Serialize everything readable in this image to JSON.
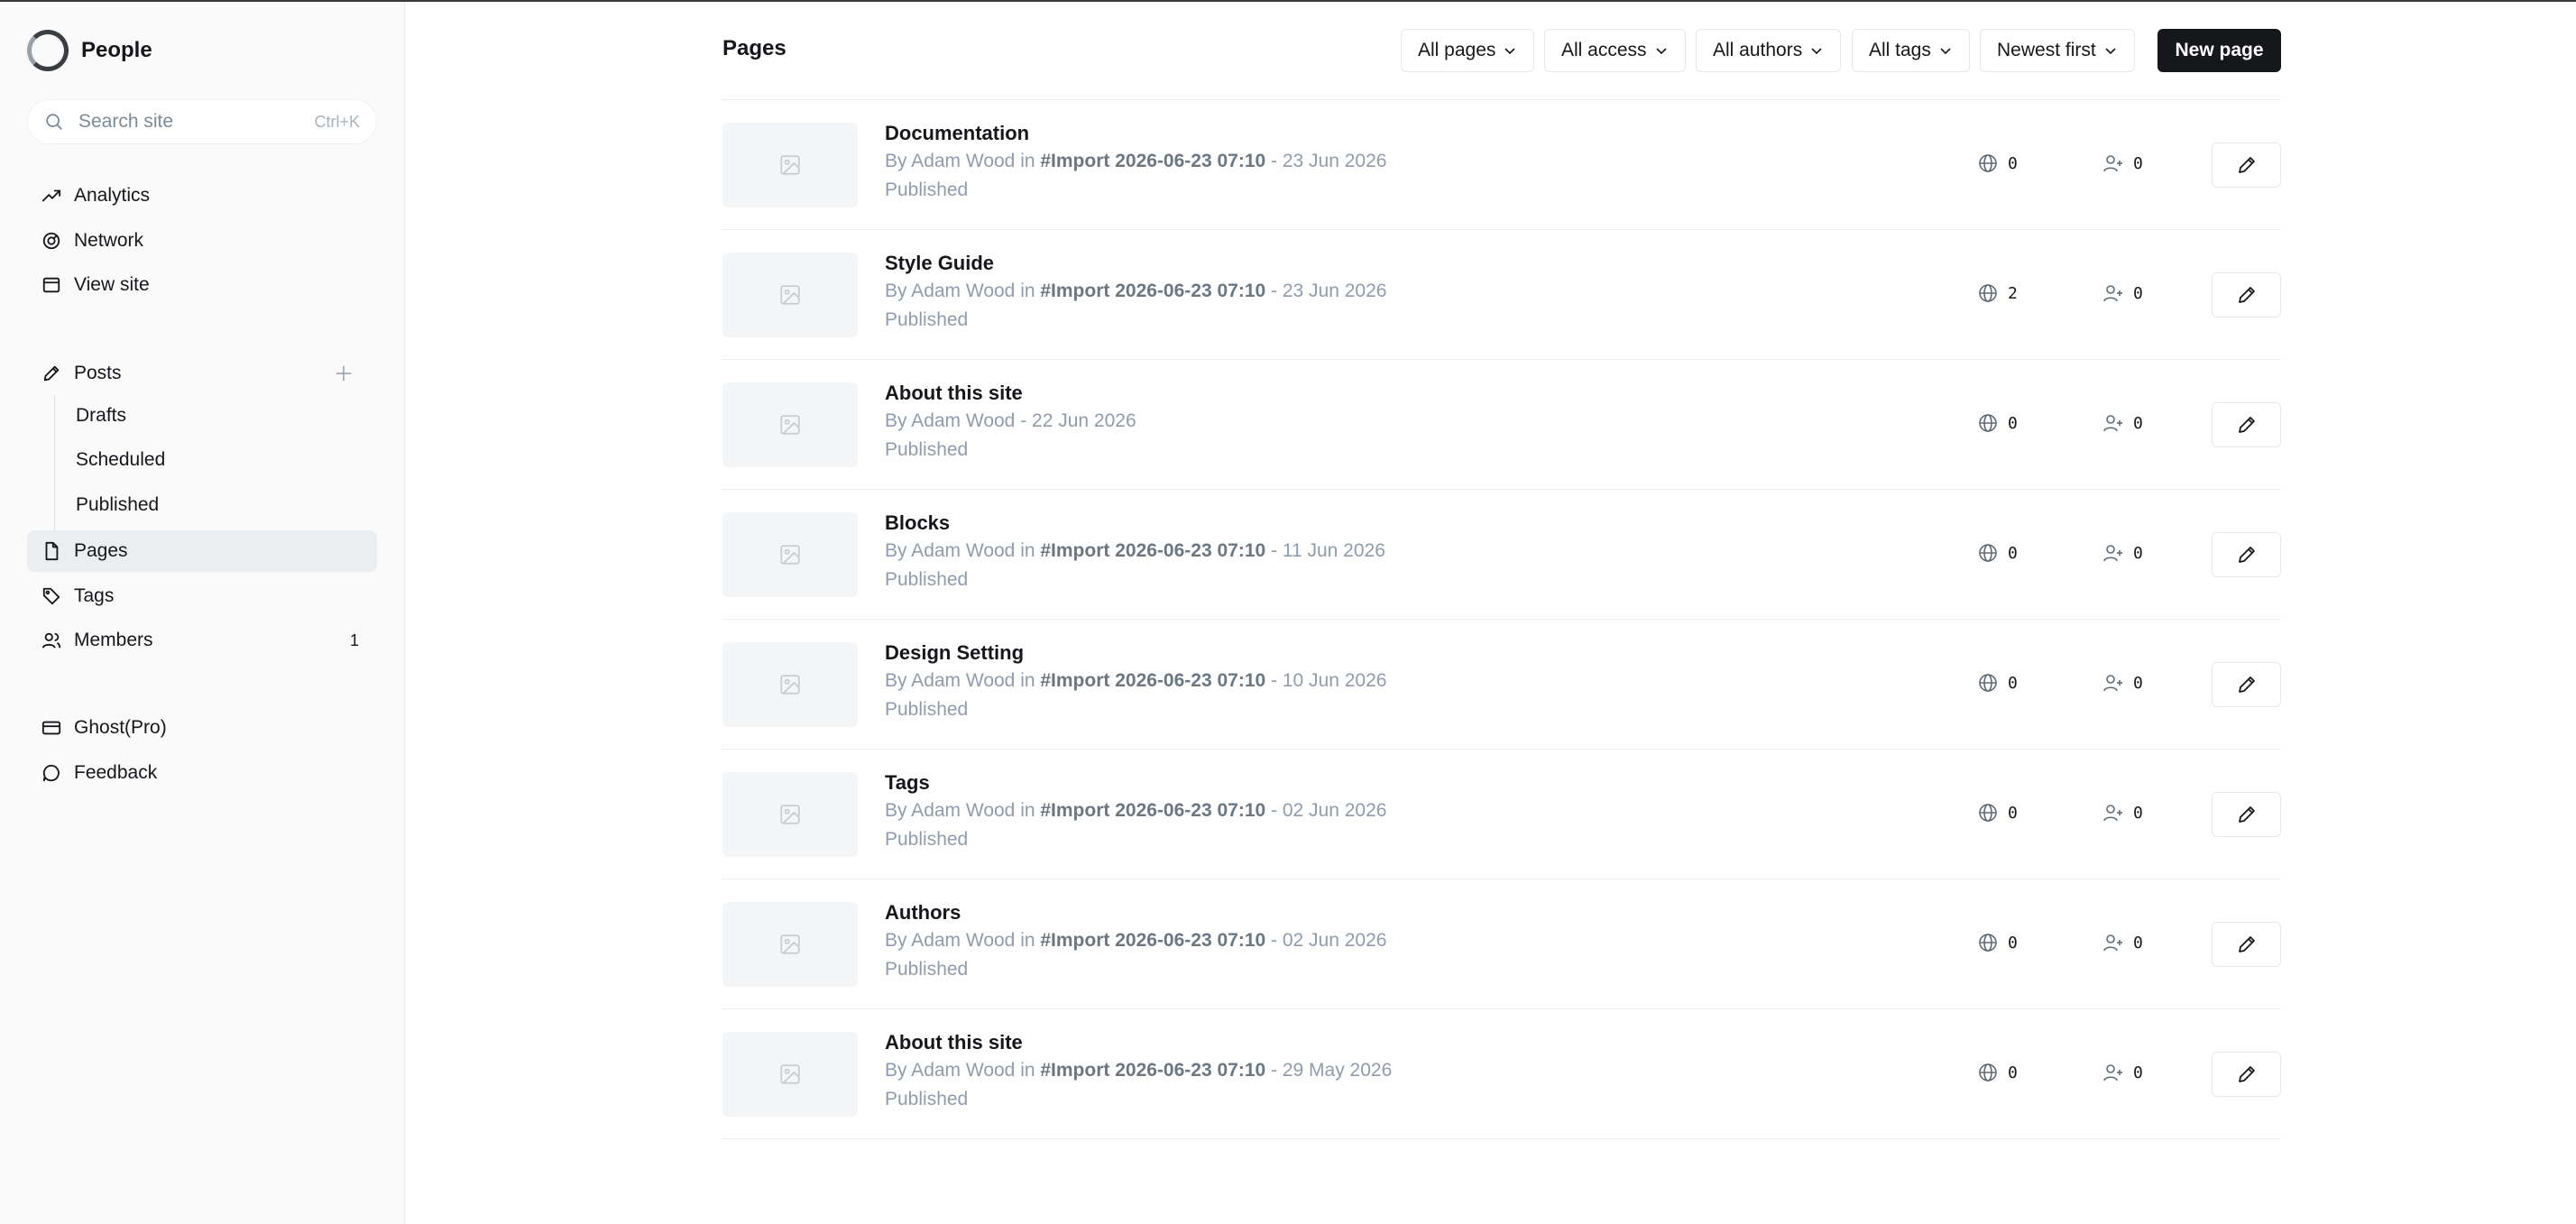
{
  "brand": {
    "name": "People"
  },
  "search": {
    "placeholder": "Search site",
    "shortcut": "Ctrl+K"
  },
  "nav_primary": [
    {
      "label": "Analytics",
      "icon": "trend-icon"
    },
    {
      "label": "Network",
      "icon": "network-icon"
    },
    {
      "label": "View site",
      "icon": "browser-icon"
    }
  ],
  "posts": {
    "label": "Posts",
    "sub": [
      "Drafts",
      "Scheduled",
      "Published"
    ]
  },
  "nav_secondary": [
    {
      "label": "Pages",
      "icon": "page-icon",
      "active": true
    },
    {
      "label": "Tags",
      "icon": "tag-icon"
    },
    {
      "label": "Members",
      "icon": "members-icon",
      "count": "1"
    }
  ],
  "nav_footer": [
    {
      "label": "Ghost(Pro)",
      "icon": "card-icon"
    },
    {
      "label": "Feedback",
      "icon": "chat-icon"
    }
  ],
  "header": {
    "title": "Pages",
    "filters": [
      "All pages",
      "All access",
      "All authors",
      "All tags",
      "Newest first"
    ],
    "new_button": "New page"
  },
  "pages": [
    {
      "title": "Documentation",
      "by": "By Adam Wood",
      "in": " in ",
      "tag": "#Import 2026-06-23 07:10",
      "date": " - 23 Jun 2026",
      "status": "Published",
      "visits": "0",
      "signups": "0"
    },
    {
      "title": "Style Guide",
      "by": "By Adam Wood",
      "in": " in ",
      "tag": "#Import 2026-06-23 07:10",
      "date": " - 23 Jun 2026",
      "status": "Published",
      "visits": "2",
      "signups": "0"
    },
    {
      "title": "About this site",
      "by": "By Adam Wood",
      "in": "",
      "tag": "",
      "date": " - 22 Jun 2026",
      "status": "Published",
      "visits": "0",
      "signups": "0"
    },
    {
      "title": "Blocks",
      "by": "By Adam Wood",
      "in": " in ",
      "tag": "#Import 2026-06-23 07:10",
      "date": " - 11 Jun 2026",
      "status": "Published",
      "visits": "0",
      "signups": "0"
    },
    {
      "title": "Design Setting",
      "by": "By Adam Wood",
      "in": " in ",
      "tag": "#Import 2026-06-23 07:10",
      "date": " - 10 Jun 2026",
      "status": "Published",
      "visits": "0",
      "signups": "0"
    },
    {
      "title": "Tags",
      "by": "By Adam Wood",
      "in": " in ",
      "tag": "#Import 2026-06-23 07:10",
      "date": " - 02 Jun 2026",
      "status": "Published",
      "visits": "0",
      "signups": "0"
    },
    {
      "title": "Authors",
      "by": "By Adam Wood",
      "in": " in ",
      "tag": "#Import 2026-06-23 07:10",
      "date": " - 02 Jun 2026",
      "status": "Published",
      "visits": "0",
      "signups": "0"
    },
    {
      "title": "About this site",
      "by": "By Adam Wood",
      "in": " in ",
      "tag": "#Import 2026-06-23 07:10",
      "date": " - 29 May 2026",
      "status": "Published",
      "visits": "0",
      "signups": "0"
    }
  ]
}
